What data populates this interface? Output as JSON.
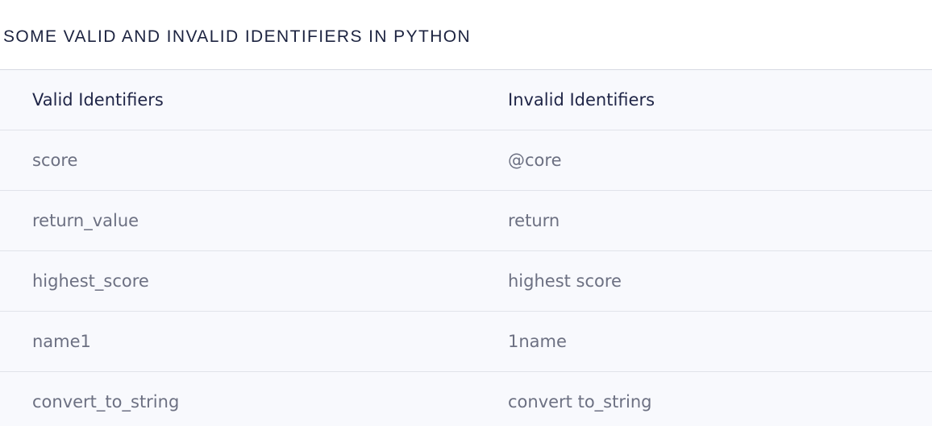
{
  "caption": "SOME VALID AND INVALID IDENTIFIERS IN PYTHON",
  "table": {
    "headers": [
      "Valid Identifiers",
      "Invalid Identifiers"
    ],
    "rows": [
      [
        "score",
        "@core"
      ],
      [
        "return_value",
        "return"
      ],
      [
        "highest_score",
        "highest score"
      ],
      [
        "name1",
        "1name"
      ],
      [
        "convert_to_string",
        "convert to_string"
      ]
    ]
  }
}
